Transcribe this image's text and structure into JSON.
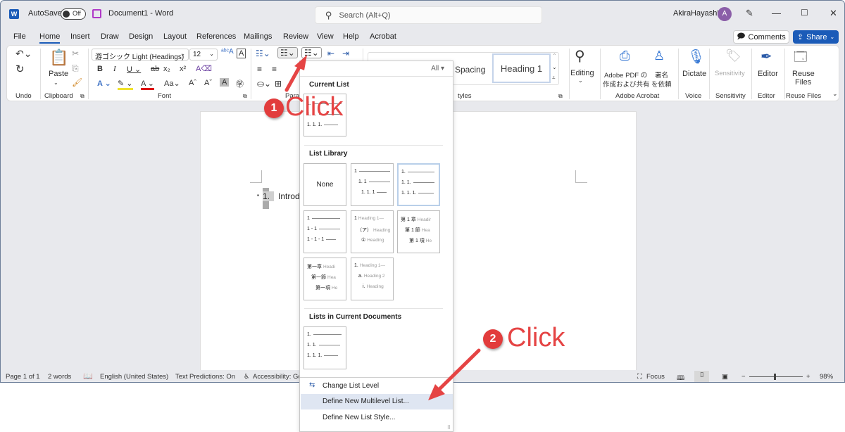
{
  "titlebar": {
    "autosave_label": "AutoSave",
    "autosave_state": "Off",
    "doc_title": "Document1  -  Word",
    "search_placeholder": "Search (Alt+Q)",
    "user_name": "AkiraHayashi",
    "avatar_initial": "A"
  },
  "menu": {
    "tabs": [
      "File",
      "Home",
      "Insert",
      "Draw",
      "Design",
      "Layout",
      "References",
      "Mailings",
      "Review",
      "View",
      "Help",
      "Acrobat"
    ],
    "active_tab": "Home",
    "comments_label": "Comments",
    "share_label": "Share"
  },
  "ribbon": {
    "undo_group": "Undo",
    "clipboard": {
      "paste_label": "Paste",
      "group": "Clipboard"
    },
    "font": {
      "name": "游ゴシック Light (Headings)",
      "size": "12",
      "group": "Font"
    },
    "paragraph_group": "Para",
    "styles": {
      "spacing_label": "Spacing",
      "heading1_label": "Heading 1",
      "group": "tyles"
    },
    "editing_label": "Editing",
    "adobe": {
      "pdf_label_1": "Adobe PDF の",
      "pdf_label_2": "作成および共有",
      "sign_label_1": "署名",
      "sign_label_2": "を依頼",
      "group": "Adobe Acrobat"
    },
    "voice": {
      "label": "Dictate",
      "group": "Voice"
    },
    "sensitivity": {
      "label": "Sensitivity",
      "group": "Sensitivity"
    },
    "editor": {
      "label": "Editor",
      "group": "Editor"
    },
    "reuse": {
      "label_1": "Reuse",
      "label_2": "Files",
      "group": "Reuse Files"
    }
  },
  "document": {
    "list_number": "1.",
    "text": "Introd"
  },
  "multilevel_dropdown": {
    "filter": "All ▾",
    "current_list_title": "Current List",
    "list_library_title": "List Library",
    "lists_in_docs_title": "Lists in Current Documents",
    "none_label": "None",
    "current_list": [
      "1.",
      "1. 1.",
      "1. 1. 1."
    ],
    "library": [
      {
        "lines": [
          "1",
          "1. 1",
          "1. 1. 1"
        ]
      },
      {
        "lines": [
          "1.",
          "1. 1.",
          "1. 1. 1."
        ]
      },
      {
        "lines": [
          "1",
          "1 - 1",
          "1 - 1 - 1"
        ]
      },
      {
        "lines": [
          "1",
          "（ア）",
          "①"
        ],
        "headings": [
          "Heading 1—",
          "Heading",
          "Heading"
        ]
      },
      {
        "lines": [
          "第 1 章",
          "第 1 節",
          "第 1 項"
        ],
        "headings": [
          "Headir",
          "Hea",
          "He"
        ]
      },
      {
        "lines": [
          "第一章",
          "第一節",
          "第一項"
        ],
        "headings": [
          "Headi",
          "Hea",
          "He"
        ]
      },
      {
        "lines": [
          "1.",
          "a.",
          "i."
        ],
        "headings": [
          "Heading 1—",
          "Heading 2",
          "Heading"
        ]
      }
    ],
    "doc_list": [
      "1.",
      "1. 1.",
      "1. 1. 1."
    ],
    "menu_items": [
      "Change List Level",
      "Define New Multilevel List...",
      "Define New List Style..."
    ],
    "highlighted_item": "Define New Multilevel List..."
  },
  "status": {
    "page": "Page 1 of 1",
    "words": "2 words",
    "language": "English (United States)",
    "predictions": "Text Predictions: On",
    "accessibility": "Accessibility: Go",
    "focus": "Focus",
    "zoom": "98%"
  },
  "annotations": {
    "step1_num": "1",
    "step1_text": "Click",
    "step2_num": "2",
    "step2_text": "Click",
    "color": "#e54444"
  }
}
